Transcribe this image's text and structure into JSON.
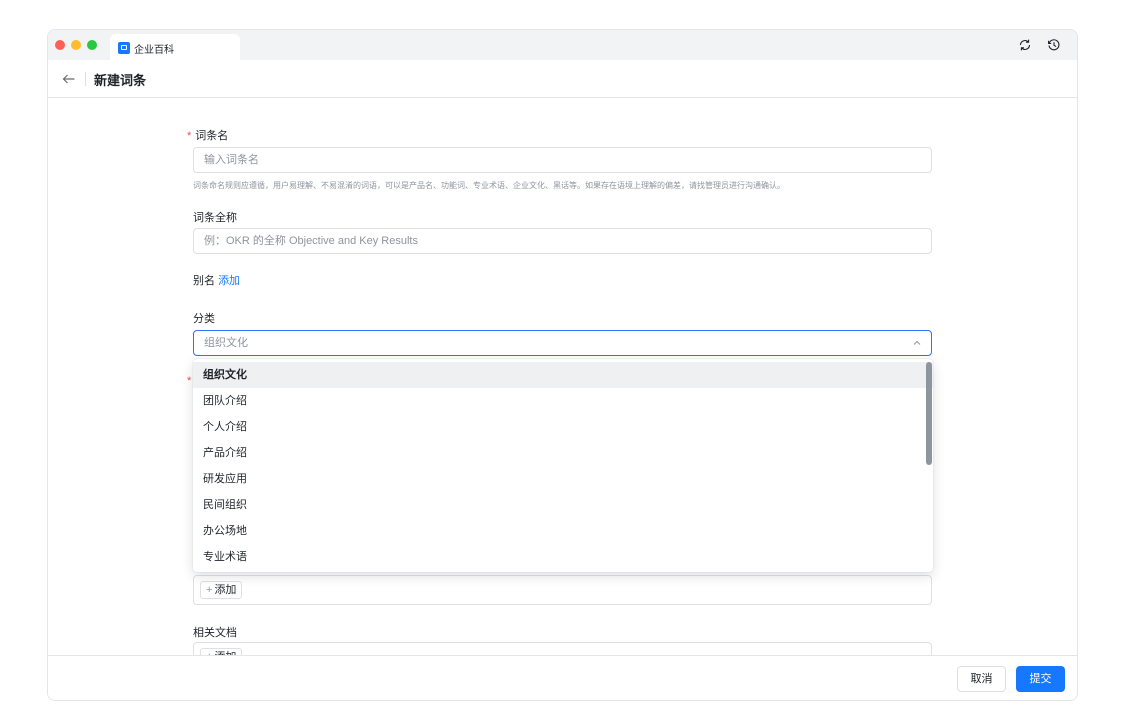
{
  "tab": {
    "title": "企业百科"
  },
  "header": {
    "title": "新建词条"
  },
  "form": {
    "name": {
      "label": "词条名",
      "required_mark": "*",
      "placeholder": "输入词条名",
      "hint": "词条命名规则应遵循，用户易理解、不易混淆的词语，可以是产品名、功能词、专业术语、企业文化、黑话等。如果存在语境上理解的偏差，请找管理员进行沟通确认。"
    },
    "full_name": {
      "label": "词条全称",
      "placeholder": "例：OKR 的全称 Objective and Key Results"
    },
    "alias": {
      "label": "别名",
      "add_link": "添加"
    },
    "category": {
      "label": "分类",
      "selected": "组织文化",
      "options": [
        "组织文化",
        "团队介绍",
        "个人介绍",
        "产品介绍",
        "研发应用",
        "民间组织",
        "办公场地",
        "专业术语"
      ]
    },
    "hidden_required_mark": "*",
    "related_add": {
      "plus": "+",
      "label": "添加"
    },
    "related_docs": {
      "label": "相关文档",
      "plus": "+",
      "add_label": "添加"
    }
  },
  "footer": {
    "cancel": "取消",
    "submit": "提交"
  },
  "colors": {
    "accent": "#1677ff",
    "required": "#f54a45",
    "hint": "#8f959e"
  }
}
